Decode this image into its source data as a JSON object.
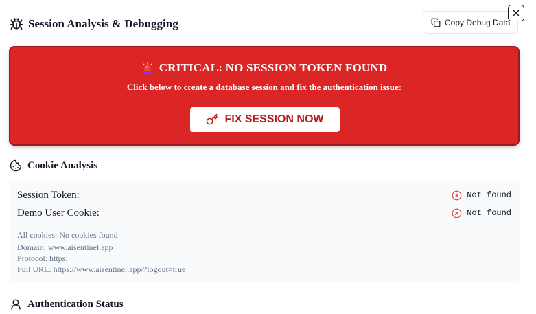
{
  "header": {
    "title": "Session Analysis & Debugging",
    "copy_label": "Copy Debug Data",
    "icons": {
      "title": "bug-icon",
      "copy": "copy-icon",
      "close": "close-icon"
    }
  },
  "alert": {
    "title": "CRITICAL: NO SESSION TOKEN FOUND",
    "subtitle": "Click below to create a database session and fix the authentication issue:",
    "button_label": "FIX SESSION NOW",
    "colors": {
      "background": "#dc2626",
      "button_text": "#b91c1c"
    },
    "icons": {
      "title": "siren-icon",
      "button": "key-icon"
    }
  },
  "cookie_analysis": {
    "heading": "Cookie Analysis",
    "rows": [
      {
        "label": "Session Token:",
        "status": "Not found"
      },
      {
        "label": "Demo User Cookie:",
        "status": "Not found"
      }
    ],
    "all_cookies": "All cookies: No cookies found",
    "domain": "Domain: www.aisentinel.app",
    "protocol": "Protocol: https:",
    "full_url": "Full URL: https://www.aisentinel.app/?logout=true",
    "icons": {
      "heading": "cookie-icon",
      "status": "x-circle-icon"
    }
  },
  "auth_status": {
    "heading": "Authentication Status",
    "icon": "user-icon"
  }
}
